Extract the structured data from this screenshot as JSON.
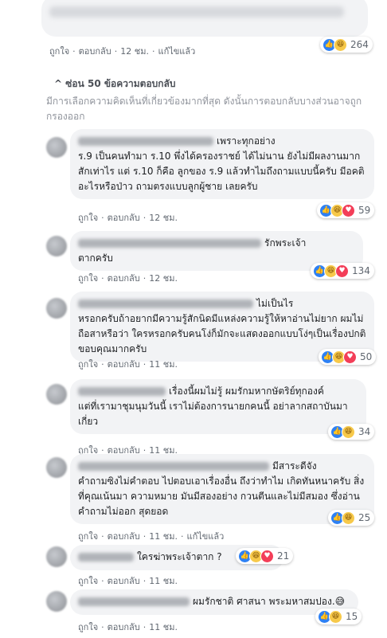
{
  "top_comment": {
    "like_label": "ถูกใจ",
    "reply_label": "ตอบกลับ",
    "time": "12 ชม.",
    "edited_label": "แก้ไขแล้ว",
    "reaction_count": "264"
  },
  "hide_replies_label": "^ ซ่อน 50 ข้อความตอบกลับ",
  "notice": "มีการเลือกความคิดเห็นที่เกี่ยวข้องมากที่สุด ดังนั้นการตอบกลับบางส่วนอาจถูกกรองออก",
  "replies": [
    {
      "text": "เพราะทุกอย่าง\nร.9 เป็นคนทำมา ร.10 พึ่งได้ครองราชย์ ได้ไม่นาน ยังไม่มีผลงานมากสักเท่าไร แต่ ร.10 ก็คือ ลูกของ ร.9 แล้วทำไมถึงถามแบบนี้ครับ มีอคติ อะไรหรือป่าว ถามตรงแบบลูกผู้ชาย เลยครับ",
      "like_label": "ถูกใจ",
      "reply_label": "ตอบกลับ",
      "time": "12 ชม.",
      "reaction_count": "59"
    },
    {
      "text": "รักพระเจ้า\nตากครับ",
      "like_label": "ถูกใจ",
      "reply_label": "ตอบกลับ",
      "time": "12 ชม.",
      "reaction_count": "134"
    },
    {
      "text": "ไม่เป็นไร\nหรอกครับถ้าอยากมีความรู้สักนิดมีแหล่งความรู้ให้หาอ่านไม่ยาก ผมไม่ถือสาหรือว่า ใครหรอกครับคนโง่ก็มักจะแสดงออกแบบโง่ๆเป็นเรื่องปกติ ขอบคุณมากครับ",
      "like_label": "ถูกใจ",
      "reply_label": "ตอบกลับ",
      "time": "11 ชม.",
      "reaction_count": "50"
    },
    {
      "text": "เรื่องนี้ผมไม่รู้ ผมรักมหากษัตริย์ทุกองค์\nแต่ที่เรามาชุมนุมวันนี้ เราไม่ต้องการนายกคนนี้ อย่าลากสถาบันมาเกี่ยว",
      "like_label": "ถูกใจ",
      "reply_label": "ตอบกลับ",
      "time": "11 ชม.",
      "reaction_count": "34"
    },
    {
      "text": "มีสาระดีจัง\nคำถามซิงไม่คำตอบ ไปตอบเอาเรื่องอื่น ถึงว่าทำไม เกิดทันหนาครับ สิ่งที่คุณเน้นมา ความหมาย มันมีสองอย่าง กวนตีนและไม่มีสมอง ซึ่งอ่านคำถามไม่ออก สุดยอด",
      "like_label": "ถูกใจ",
      "reply_label": "ตอบกลับ",
      "time": "11 ชม.",
      "edited_label": "แก้ไขแล้ว",
      "reaction_count": "25"
    },
    {
      "text": "ใครฆ่าพระเจ้าตาก ?",
      "like_label": "ถูกใจ",
      "reply_label": "ตอบกลับ",
      "time": "11 ชม.",
      "reaction_count": "21"
    },
    {
      "text": "ผมรักชาติ ศาสนา พระมหาสมปอง.",
      "emoji": "😅",
      "like_label": "ถูกใจ",
      "reply_label": "ตอบกลับ",
      "time": "11 ชม.",
      "reaction_count": "15"
    }
  ],
  "colors": {
    "link": "#606770",
    "bubble": "#f2f3f5",
    "like": "#2e81f4",
    "love": "#f33e58",
    "haha": "#f7c94a"
  }
}
